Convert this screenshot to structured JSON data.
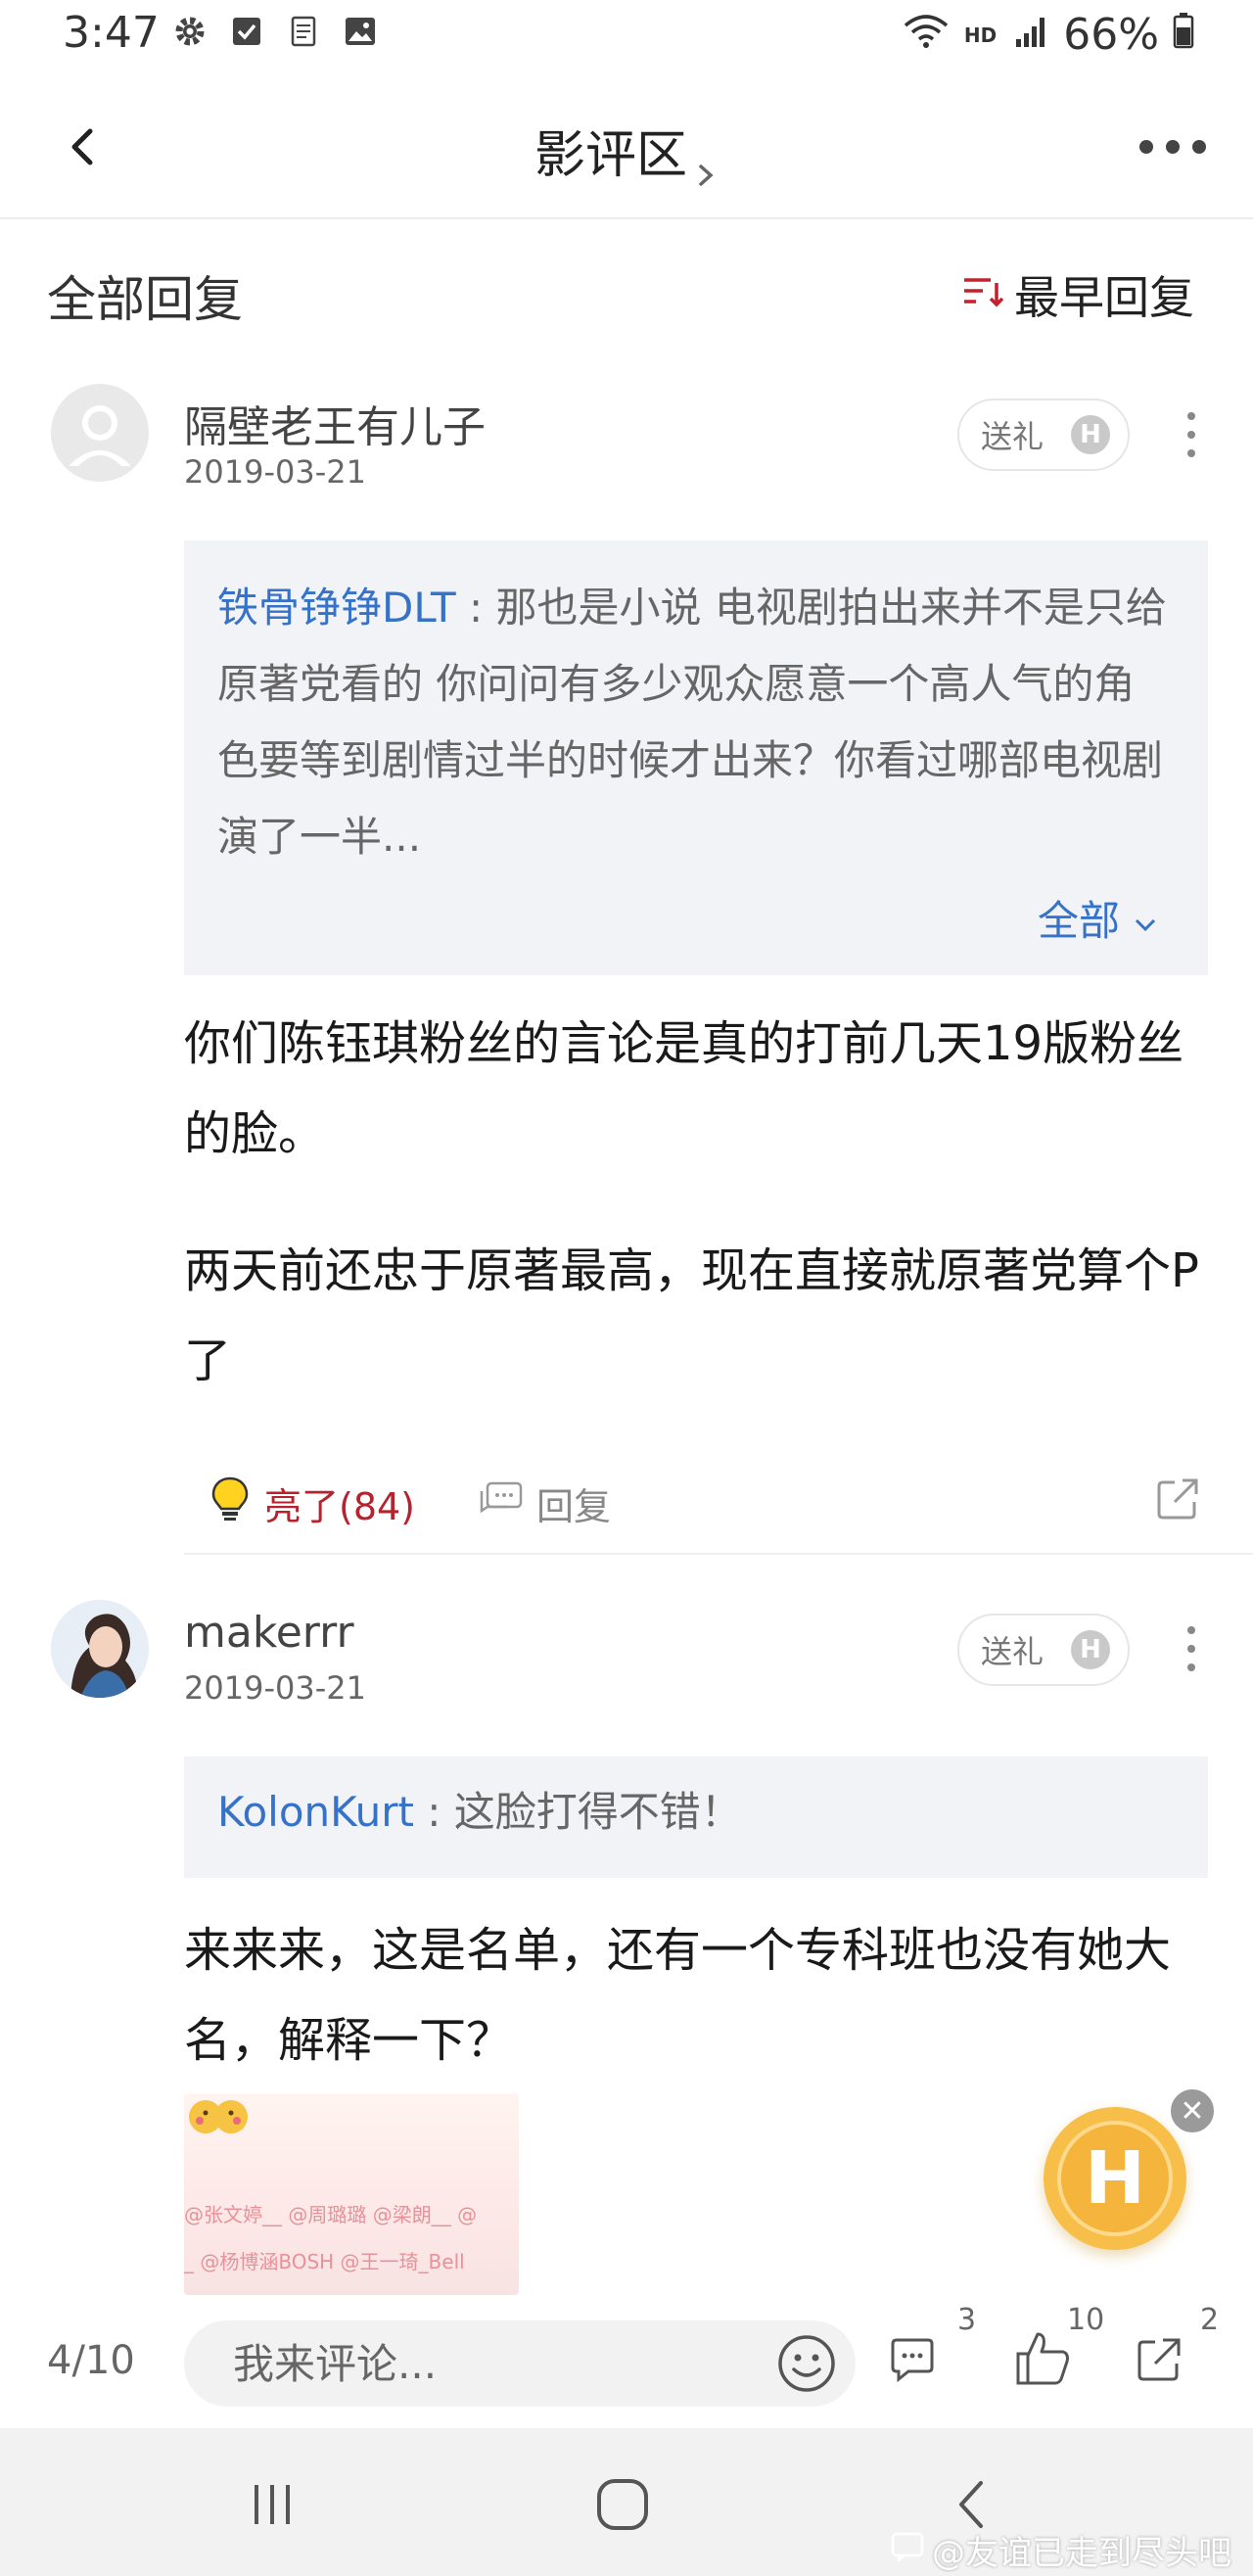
{
  "status_bar": {
    "time": "3:47",
    "network": "HD",
    "battery": "66%"
  },
  "header": {
    "title": "影评区"
  },
  "section": {
    "title": "全部回复",
    "sort_label": "最早回复"
  },
  "comments": [
    {
      "username": "隔壁老王有儿子",
      "date": "2019-03-21",
      "gift_label": "送礼",
      "gift_coin": "H",
      "quote": {
        "author": "铁骨铮铮DLT",
        "separator": " : ",
        "text": "那也是小说 电视剧拍出来并不是只给原著党看的 你问问有多少观众愿意一个高人气的角色要等到剧情过半的时候才出来？你看过哪部电视剧演了一半...",
        "expand_label": "全部"
      },
      "body_p1": "你们陈钰琪粉丝的言论是真的打前几天19版粉丝的脸。",
      "body_p2": "两天前还忠于原著最高，现在直接就原著党算个P了",
      "like_label": "亮了(84)",
      "reply_label": "回复"
    },
    {
      "username": "makerrr",
      "date": "2019-03-21",
      "gift_label": "送礼",
      "gift_coin": "H",
      "quote": {
        "author": "KolonKurt",
        "separator": " : ",
        "text": "这脸打得不错！"
      },
      "body": "来来来，这是名单，还有一个专科班也没有她大名，解释一下？",
      "image_text_line1": "@张文婷__ @周璐璐 @梁朗__ @",
      "image_text_line2": "_ @杨博涵BOSH @王一琦_Bell"
    }
  ],
  "floating": {
    "label": "H"
  },
  "bottom_bar": {
    "page": "4/10",
    "input_placeholder": "我来评论...",
    "comments_count": "3",
    "likes_count": "10",
    "shares_count": "2"
  },
  "watermark": "@友谊已走到尽头吧",
  "colors": {
    "link": "#3572c8",
    "like": "#b5232e",
    "accent": "#f5b43b",
    "sort_icon": "#c4212c"
  }
}
